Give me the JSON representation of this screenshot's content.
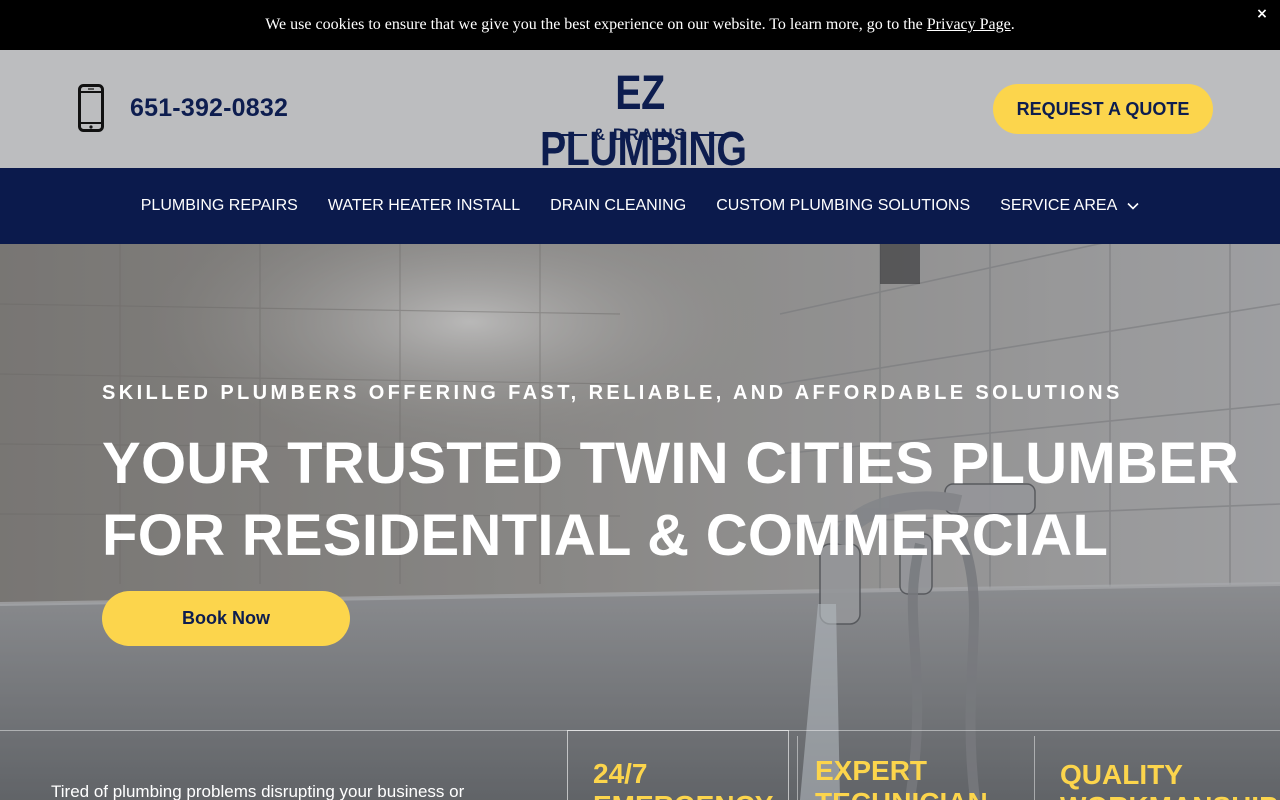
{
  "cookie_bar": {
    "text": "We use cookies to ensure that we give you the best experience on our website. To learn more, go to the ",
    "link": "Privacy Page",
    "end": ".",
    "close": "×"
  },
  "header": {
    "phone": "651-392-0832",
    "logo_main": "EZ PLUMBING",
    "logo_sub": "& DRAINS",
    "quote_button": "REQUEST A QUOTE"
  },
  "nav": {
    "items": [
      {
        "label": "PLUMBING REPAIRS"
      },
      {
        "label": "WATER HEATER INSTALL"
      },
      {
        "label": "DRAIN CLEANING"
      },
      {
        "label": "CUSTOM PLUMBING SOLUTIONS"
      },
      {
        "label": "SERVICE AREA"
      }
    ]
  },
  "hero": {
    "eyebrow": "SKILLED PLUMBERS OFFERING FAST, RELIABLE, AND AFFORDABLE SOLUTIONS",
    "title_line1": "YOUR TRUSTED TWIN CITIES PLUMBER",
    "title_line2": "FOR RESIDENTIAL & COMMERCIAL",
    "book_button": "Book Now"
  },
  "intro": {
    "text": "Tired of plumbing problems disrupting your business or"
  },
  "features": [
    {
      "line1": "24/7",
      "line2": "EMERGENCY"
    },
    {
      "line1": "EXPERT",
      "line2": "TECHNICIAN"
    },
    {
      "line1": "QUALITY",
      "line2": "WORKMANSHIP"
    }
  ],
  "colors": {
    "navy": "#0b1a4c",
    "accent_yellow": "#fcd54c",
    "header_gray": "#bcbdbf"
  }
}
